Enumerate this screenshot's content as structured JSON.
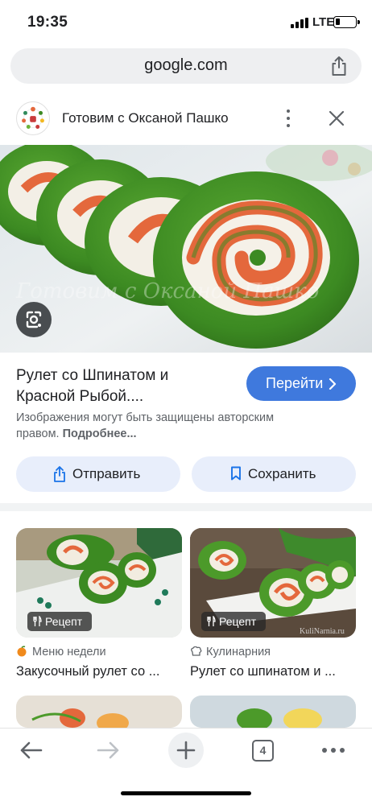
{
  "status_bar": {
    "time": "19:35",
    "network": "LTE"
  },
  "browser": {
    "url": "google.com"
  },
  "source": {
    "name": "Готовим с Оксаной Пашко"
  },
  "image": {
    "watermark": "Готовим с Оксаной Пашко"
  },
  "result": {
    "title_line1": "Рулет со Шпинатом и",
    "title_line2": "Красной Рыбой....",
    "visit_label": "Перейти",
    "copyright_line1": "Изображения могут быть защищены авторским",
    "copyright_line2_prefix": "правом.",
    "copyright_more": "Подробнее...",
    "send_label": "Отправить",
    "save_label": "Сохранить"
  },
  "related": [
    {
      "badge": "Рецепт",
      "source": "Меню недели",
      "title": "Закусочный рулет со ..."
    },
    {
      "badge": "Рецепт",
      "source": "Кулинарния",
      "title": "Рулет со шпинатом и ...",
      "watermark": "KuliNarnia.ru"
    }
  ],
  "toolbar": {
    "tab_count": "4"
  },
  "colors": {
    "accent": "#3f79dd",
    "pill_bg": "#e8eefb",
    "spinach": "#3c8a22",
    "salmon": "#e4683c"
  },
  "icons": [
    "signal-icon",
    "battery-icon",
    "share-icon",
    "more-vert-icon",
    "close-icon",
    "lens-icon",
    "chevron-right-icon",
    "bookmark-icon",
    "cutlery-icon",
    "back-icon",
    "forward-icon",
    "plus-icon",
    "tabs-icon",
    "more-horiz-icon"
  ]
}
